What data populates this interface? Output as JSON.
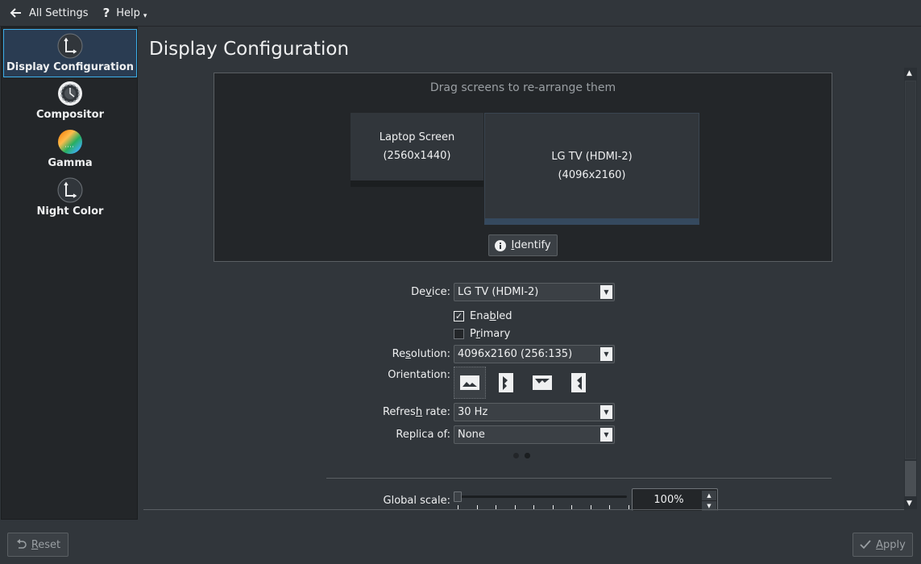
{
  "toolbar": {
    "back_label": "All Settings",
    "help_label": "Help"
  },
  "sidebar": {
    "items": [
      {
        "label": "Display Configuration",
        "icon": "display-config-icon"
      },
      {
        "label": "Compositor",
        "icon": "compositor-icon"
      },
      {
        "label": "Gamma",
        "icon": "gamma-icon"
      },
      {
        "label": "Night Color",
        "icon": "night-color-icon"
      }
    ]
  },
  "main": {
    "title": "Display Configuration",
    "arrange_hint": "Drag screens to re-arrange them",
    "screens": [
      {
        "name": "Laptop Screen",
        "resolution": "(2560x1440)"
      },
      {
        "name": "LG TV (HDMI-2)",
        "resolution": "(4096x2160)"
      }
    ],
    "identify_pre": "",
    "identify_u": "I",
    "identify_post": "dentify"
  },
  "form": {
    "device_label_pre": "De",
    "device_label_u": "v",
    "device_label_post": "ice:",
    "device_value": "LG TV (HDMI-2)",
    "enabled_pre": "Ena",
    "enabled_u": "b",
    "enabled_post": "led",
    "enabled_checked": true,
    "primary_pre": "P",
    "primary_u": "r",
    "primary_post": "imary",
    "primary_checked": false,
    "resolution_label_pre": "Re",
    "resolution_label_u": "s",
    "resolution_label_post": "olution:",
    "resolution_value": "4096x2160 (256:135)",
    "orientation_label": "Orientation:",
    "refresh_label_pre": "Refres",
    "refresh_label_u": "h",
    "refresh_label_post": " rate:",
    "refresh_value": "30 Hz",
    "replica_label": "Replica of:",
    "replica_value": "None",
    "global_scale_label": "Global scale:",
    "global_scale_value": "100%",
    "global_scale_fraction": 0.0
  },
  "footer": {
    "reset_u": "R",
    "reset_post": "eset",
    "apply_u": "A",
    "apply_post": "pply"
  },
  "colors": {
    "background": "#31363b",
    "sidebar": "#232629",
    "accent": "#3daee9",
    "text": "#eff0f1"
  }
}
